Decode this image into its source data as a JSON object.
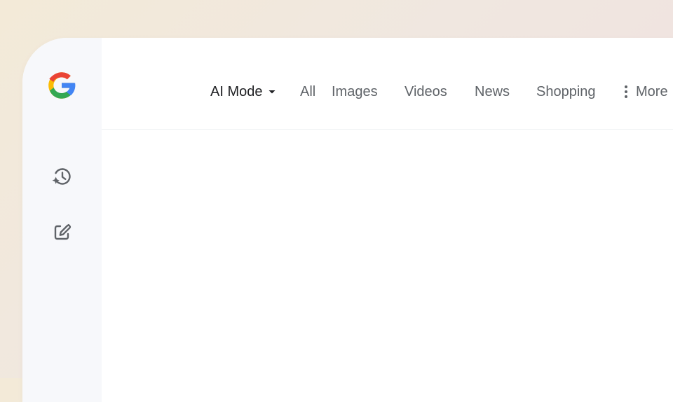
{
  "app": {
    "logo_icon": "google-g-logo",
    "accent_colors": {
      "google_blue": "#4285F4",
      "google_red": "#EA4335",
      "google_yellow": "#FBBC05",
      "google_green": "#34A853",
      "active_text": "#202124",
      "inactive_text": "#5f6368",
      "sidebar_bg": "#f7f8fb"
    }
  },
  "sidebar": {
    "buttons": [
      {
        "icon": "history-sparkle-icon"
      },
      {
        "icon": "edit-square-icon"
      }
    ]
  },
  "tabs": [
    {
      "label": "AI Mode",
      "active": true,
      "icon": "dropdown-arrow-icon"
    },
    {
      "label": "All",
      "active": false
    },
    {
      "label": "Images",
      "active": false
    },
    {
      "label": "Videos",
      "active": false
    },
    {
      "label": "News",
      "active": false
    },
    {
      "label": "Shopping",
      "active": false
    },
    {
      "label": "More",
      "active": false,
      "icon": "more-vertical-icon"
    }
  ]
}
